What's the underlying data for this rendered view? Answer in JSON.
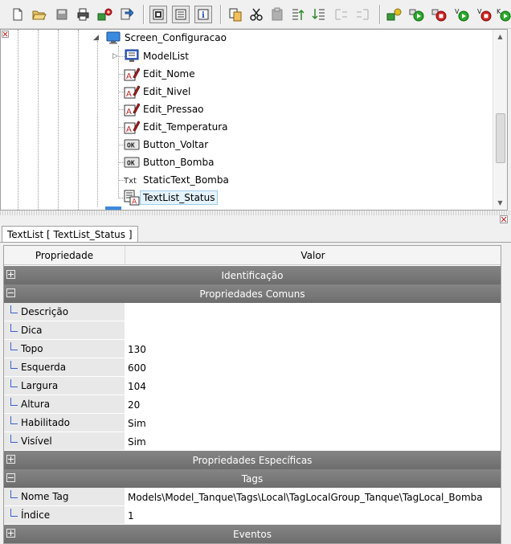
{
  "toolbar": {
    "icons": [
      "new-file-icon",
      "open-folder-icon",
      "save-icon",
      "print-icon",
      "settings-key-icon",
      "export-icon",
      "tree-view-icon",
      "list-view-icon",
      "info-icon",
      "copy-icon",
      "cut-icon",
      "paste-icon",
      "move-up-icon",
      "move-down-icon",
      "indent-icon",
      "outdent-icon",
      "build-icon",
      "run-icon",
      "stop-icon",
      "run-v-icon",
      "stop-v-icon",
      "run-k-icon"
    ]
  },
  "tree": {
    "nodes": [
      {
        "label": "Screen_Configuracao",
        "icon": "screen-icon"
      },
      {
        "label": "ModelList",
        "icon": "model-list-icon"
      },
      {
        "label": "Edit_Nome",
        "icon": "edit-field-icon"
      },
      {
        "label": "Edit_Nivel",
        "icon": "edit-field-icon"
      },
      {
        "label": "Edit_Pressao",
        "icon": "edit-field-icon"
      },
      {
        "label": "Edit_Temperatura",
        "icon": "edit-field-icon"
      },
      {
        "label": "Button_Voltar",
        "icon": "ok-button-icon"
      },
      {
        "label": "Button_Bomba",
        "icon": "ok-button-icon"
      },
      {
        "label": "StaticText_Bomba",
        "icon": "static-text-icon"
      },
      {
        "label": "TextList_Status",
        "icon": "text-list-icon"
      }
    ],
    "ok_glyph": "OK",
    "txt_glyph": "Txt"
  },
  "tab": {
    "label": "TextList [ TextList_Status ]"
  },
  "grid": {
    "header": {
      "property": "Propriedade",
      "value": "Valor"
    },
    "cat_identificacao": "Identificação",
    "cat_comuns": "Propriedades Comuns",
    "comuns": [
      {
        "name": "Descrição",
        "value": ""
      },
      {
        "name": "Dica",
        "value": ""
      },
      {
        "name": "Topo",
        "value": "130"
      },
      {
        "name": "Esquerda",
        "value": "600"
      },
      {
        "name": "Largura",
        "value": "104"
      },
      {
        "name": "Altura",
        "value": "20"
      },
      {
        "name": "Habilitado",
        "value": "Sim"
      },
      {
        "name": "Visível",
        "value": "Sim"
      }
    ],
    "cat_especificas": "Propriedades Específicas",
    "cat_tags": "Tags",
    "tags": [
      {
        "name": "Nome Tag",
        "value": "Models\\Model_Tanque\\Tags\\Local\\TagLocalGroup_Tanque\\TagLocal_Bomba"
      },
      {
        "name": "Índice",
        "value": "1"
      }
    ],
    "cat_eventos": "Eventos"
  },
  "colors": {
    "category_bar": "#7a7a7a",
    "selection": "#e5f3fb",
    "name_cell": "#e8e8e8"
  }
}
